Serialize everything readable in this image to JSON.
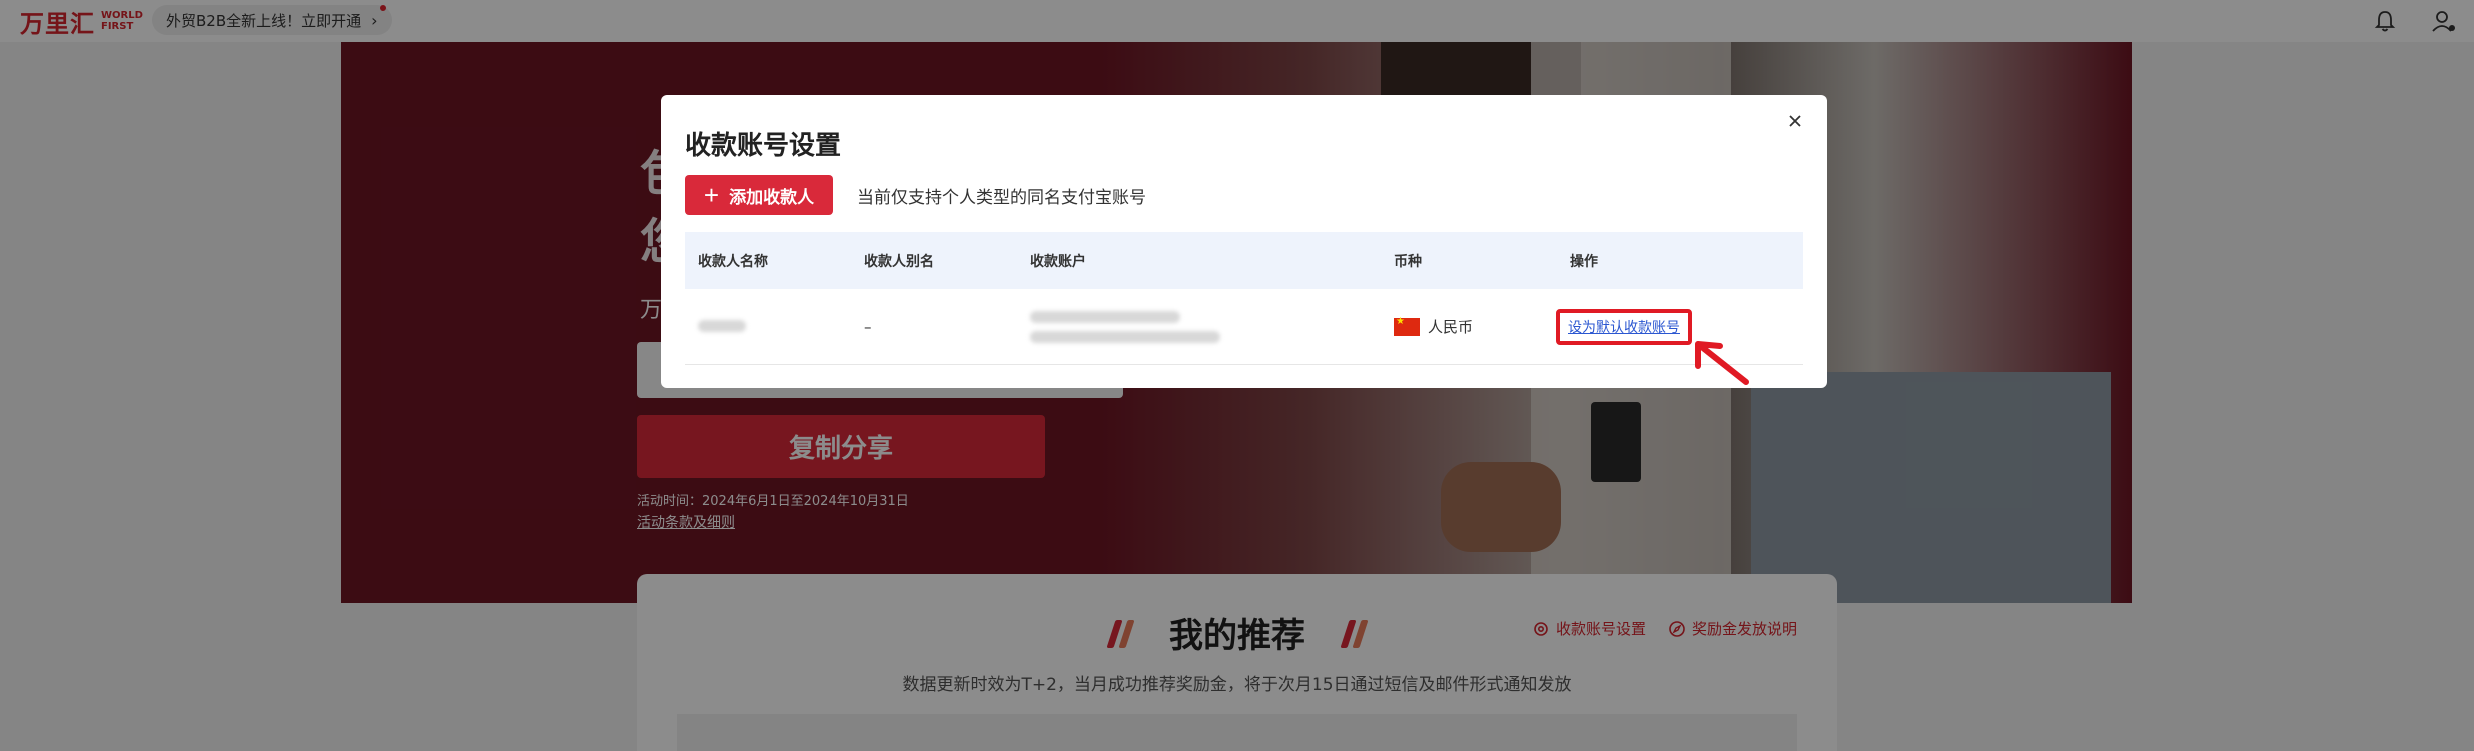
{
  "topbar": {
    "logo_cn": "万里汇",
    "logo_en_line1": "WORLD",
    "logo_en_line2": "FIRST",
    "promo_text": "外贸B2B全新上线！立即开通",
    "promo_chevron": "›"
  },
  "hero": {
    "headline_line1": "包",
    "headline_line2": "您",
    "subline": "万",
    "share_button": "复制分享",
    "activity_time": "活动时间：2024年6月1日至2024年10月31日",
    "terms_link": "活动条款及细则"
  },
  "recommend": {
    "title": "我的推荐",
    "account_settings_link": "收款账号设置",
    "bonus_info_link": "奖励金发放说明",
    "note": "数据更新时效为T+2，当月成功推荐奖励金，将于次月15日通过短信及邮件形式通知发放"
  },
  "modal": {
    "title": "收款账号设置",
    "add_button": "添加收款人",
    "hint": "当前仅支持个人类型的同名支付宝账号",
    "columns": [
      "收款人名称",
      "收款人别名",
      "收款账户",
      "币种",
      "操作"
    ],
    "rows": [
      {
        "name": "",
        "alias": "–",
        "account": "",
        "currency": "人民币",
        "action": "设为默认收款账号"
      }
    ]
  },
  "colors": {
    "brand_red": "#d9293a",
    "link_blue": "#2b57d1",
    "highlight_red": "#e01a24"
  }
}
